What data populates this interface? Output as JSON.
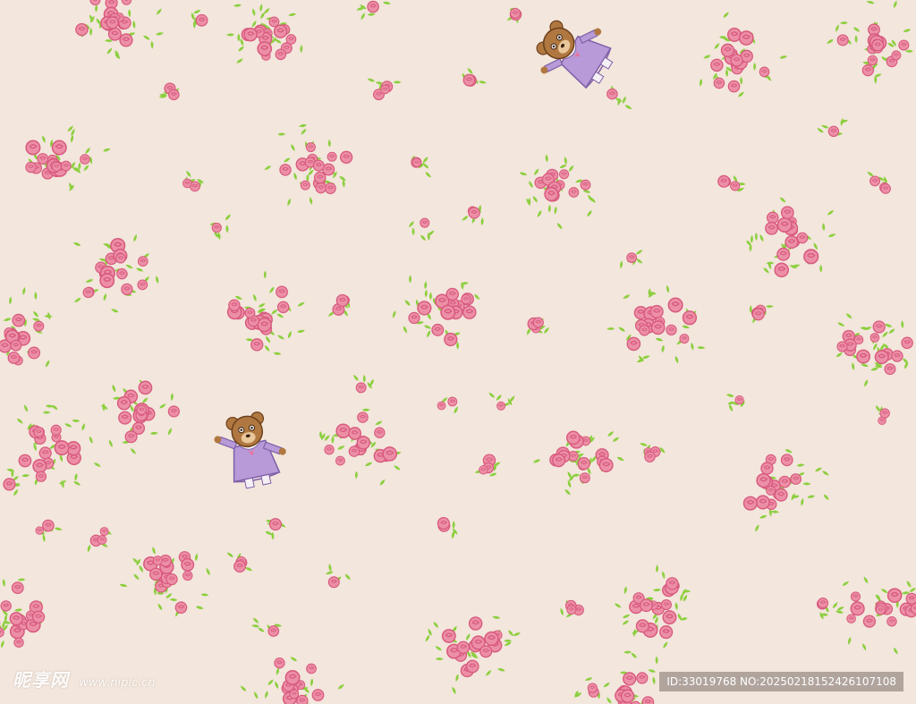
{
  "pattern": {
    "background_color": "#f3e6dc",
    "rose_color": "#ec8fa6",
    "rose_outline_color": "#d85a7e",
    "leaf_color": "#8ccf3f",
    "bear_fur_color": "#b07840",
    "bear_dress_color": "#b89ad8",
    "motifs": [
      "rose-bouquet",
      "teddy-bear-in-purple-dress"
    ]
  },
  "watermark": {
    "brand": "昵享网",
    "url": "www.nipic.cn",
    "id_text": "ID:33019768 NO:20250218152426107108"
  }
}
